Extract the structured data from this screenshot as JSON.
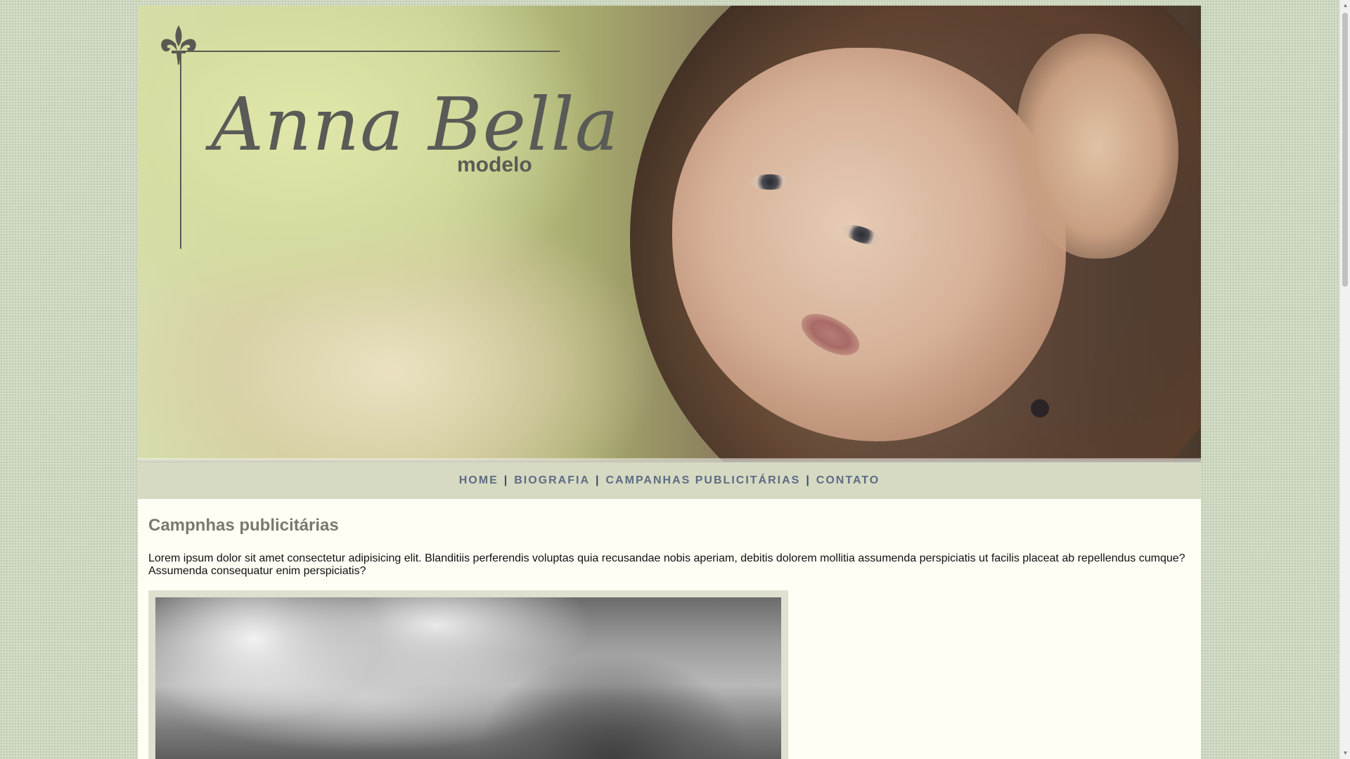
{
  "header": {
    "logo_name": "Anna Bella",
    "logo_sub": "modelo",
    "logo_icon": "fleur-de-lis-icon"
  },
  "nav": {
    "items": [
      {
        "label": "HOME"
      },
      {
        "label": "BIOGRAFIA"
      },
      {
        "label": "CAMPANHAS PUBLICITÁRIAS"
      },
      {
        "label": "CONTATO"
      }
    ],
    "separator": "|"
  },
  "main": {
    "title": "Campnhas publicitárias",
    "intro": "Lorem ipsum dolor sit amet consectetur adipisicing elit. Blanditiis perferendis voluptas quia recusandae nobis aperiam, debitis dolorem mollitia assumenda perspiciatis ut facilis placeat ab repellendus cumque? Assumenda consequatur enim perspiciatis?"
  },
  "colors": {
    "page_background": "#d3dcc6",
    "content_background": "#fefef5",
    "nav_background": "#d6dac3",
    "nav_text": "#5d6b83",
    "title_text": "#7a7a6c"
  }
}
